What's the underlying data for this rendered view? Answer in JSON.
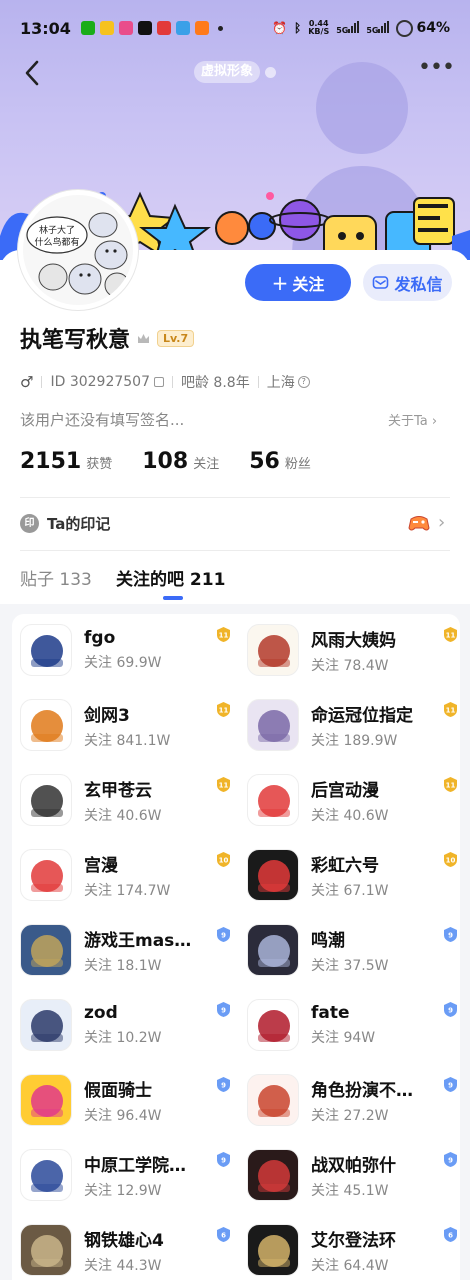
{
  "status_bar": {
    "time": "13:04",
    "speed_top": "0.44",
    "speed_bottom": "KB/S",
    "net1": "5G",
    "net2": "5G",
    "battery": "64%"
  },
  "header": {
    "virtual_image_label": "虚拟形象",
    "more_icon": "more-dots-icon"
  },
  "avatar_text": {
    "line1": "林子大了",
    "line2": "什么鸟都有"
  },
  "actions": {
    "follow_label": "关注",
    "follow_plus": "+",
    "message_label": "发私信"
  },
  "profile": {
    "name": "执笔写秋意",
    "level": "Lv.7",
    "gender_icon": "♂",
    "id_text": "ID 302927507",
    "age_text": "吧龄 8.8年",
    "location": "上海",
    "signature": "该用户还没有填写签名...",
    "about_label": "关于Ta"
  },
  "stats": [
    {
      "value": "2151",
      "label": "获赞"
    },
    {
      "value": "108",
      "label": "关注"
    },
    {
      "value": "56",
      "label": "粉丝"
    }
  ],
  "mark": {
    "icon_text": "印",
    "label": "Ta的印记"
  },
  "tabs": [
    {
      "label": "贴子 133"
    },
    {
      "label": "关注的吧 211"
    }
  ],
  "colors": {
    "accent": "#3b6bf7",
    "gold_badge": "#f0b429",
    "blue_badge": "#6a9cf5",
    "hero": "#c8c2f3"
  },
  "forums": [
    {
      "name": "fgo",
      "follows": "关注 69.9W",
      "level": "11",
      "badge": "gold",
      "icon": "fate-grand-order-logo"
    },
    {
      "name": "风雨大姨妈",
      "follows": "关注 78.4W",
      "level": "11",
      "badge": "gold",
      "icon": "calligraphy-text-icon"
    },
    {
      "name": "剑网3",
      "follows": "关注 841.1W",
      "level": "11",
      "badge": "gold",
      "icon": "jx3-logo"
    },
    {
      "name": "命运冠位指定",
      "follows": "关注 189.9W",
      "level": "11",
      "badge": "gold",
      "icon": "fate-character-avatar"
    },
    {
      "name": "玄甲苍云",
      "follows": "关注 40.6W",
      "level": "11",
      "badge": "gold",
      "icon": "helmet-emblem-icon"
    },
    {
      "name": "后宫动漫",
      "follows": "关注 40.6W",
      "level": "11",
      "badge": "gold",
      "icon": "animation-logo"
    },
    {
      "name": "宫漫",
      "follows": "关注 174.7W",
      "level": "10",
      "badge": "gold",
      "icon": "animation-logo"
    },
    {
      "name": "彩虹六号",
      "follows": "关注 67.1W",
      "level": "10",
      "badge": "gold",
      "icon": "rainbow-six-logo"
    },
    {
      "name": "游戏王mas…",
      "follows": "关注 18.1W",
      "level": "9",
      "badge": "blue",
      "icon": "yugioh-master-duel-logo"
    },
    {
      "name": "鸣潮",
      "follows": "关注 37.5W",
      "level": "9",
      "badge": "blue",
      "icon": "wuthering-waves-avatar"
    },
    {
      "name": "zod",
      "follows": "关注 10.2W",
      "level": "9",
      "badge": "blue",
      "icon": "anime-girl-avatar"
    },
    {
      "name": "fate",
      "follows": "关注 94W",
      "level": "9",
      "badge": "blue",
      "icon": "fate-stay-night-logo"
    },
    {
      "name": "假面骑士",
      "follows": "关注 96.4W",
      "level": "9",
      "badge": "blue",
      "icon": "kamen-rider-logo"
    },
    {
      "name": "角色扮演不…",
      "follows": "关注 27.2W",
      "level": "9",
      "badge": "blue",
      "icon": "cosplay-avatar"
    },
    {
      "name": "中原工学院…",
      "follows": "关注 12.9W",
      "level": "9",
      "badge": "blue",
      "icon": "university-seal"
    },
    {
      "name": "战双帕弥什",
      "follows": "关注 45.1W",
      "level": "9",
      "badge": "blue",
      "icon": "punishing-gray-raven-avatar"
    },
    {
      "name": "钢铁雄心4",
      "follows": "关注 44.3W",
      "level": "6",
      "badge": "blue",
      "icon": "hearts-of-iron-logo"
    },
    {
      "name": "艾尔登法环",
      "follows": "关注 64.4W",
      "level": "6",
      "badge": "blue",
      "icon": "elden-ring-logo"
    }
  ]
}
